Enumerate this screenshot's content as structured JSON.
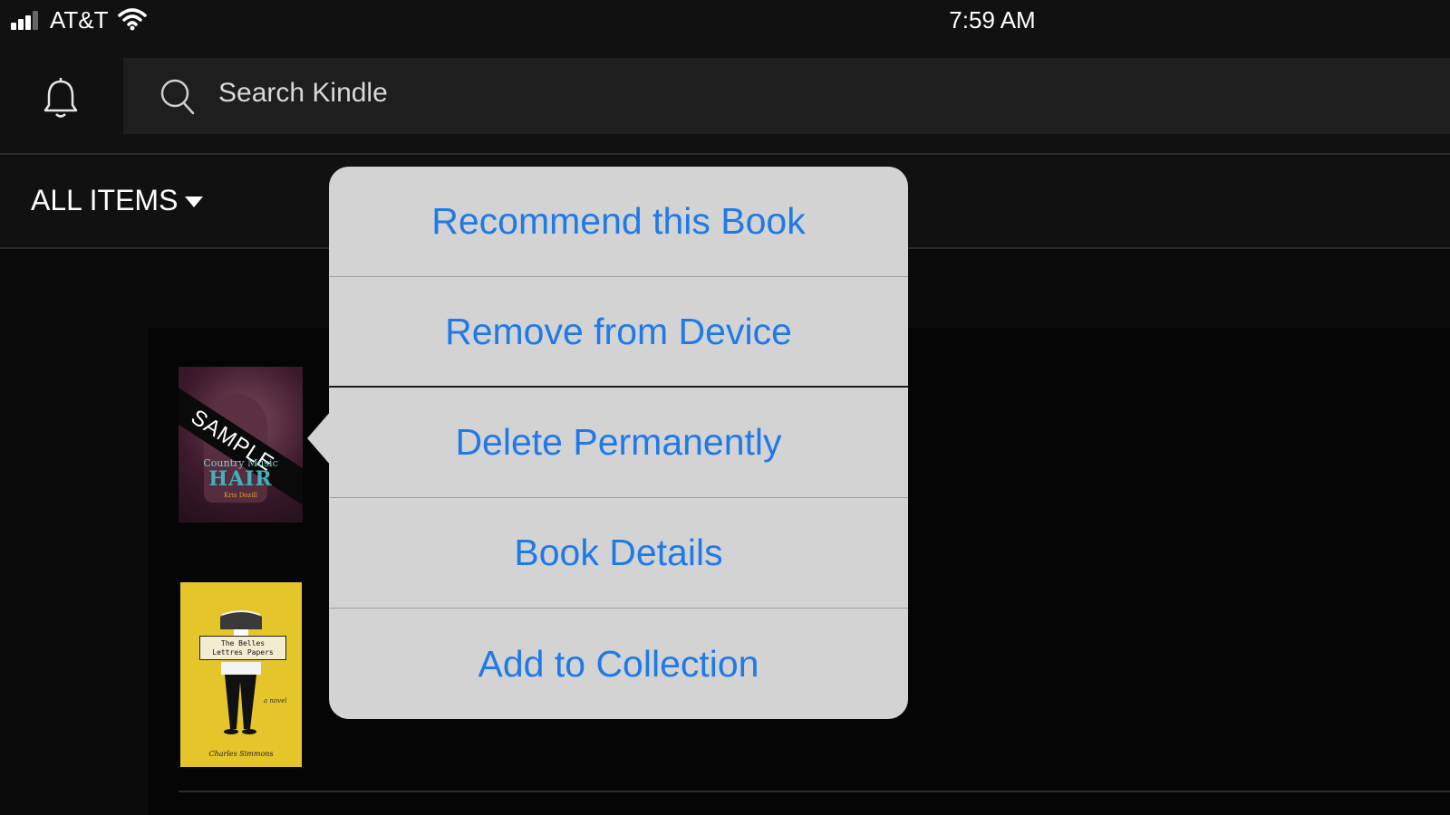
{
  "status_bar": {
    "carrier": "AT&T",
    "time": "7:59 AM",
    "signal_icon": "signal-bars-icon",
    "wifi_icon": "wifi-icon"
  },
  "header": {
    "notification_icon": "bell-icon",
    "search": {
      "icon": "search-icon",
      "placeholder": "Search Kindle"
    }
  },
  "filter": {
    "label": "ALL ITEMS",
    "icon": "caret-down-icon"
  },
  "library": {
    "books": [
      {
        "badge": "SAMPLE",
        "cover_title_line1": "Country Music",
        "cover_title_line2": "HAIR",
        "cover_author": "Kris Dozill"
      },
      {
        "cover_title_line1": "The Belles",
        "cover_title_line2": "Lettres Papers",
        "cover_subtitle": "a novel",
        "cover_author": "Charles Simmons"
      }
    ]
  },
  "context_menu": {
    "items": [
      {
        "label": "Recommend this Book"
      },
      {
        "label": "Remove from Device"
      },
      {
        "label": "Delete Permanently"
      },
      {
        "label": "Book Details"
      },
      {
        "label": "Add to Collection"
      }
    ]
  },
  "colors": {
    "accent": "#1f7ae8",
    "popover_bg": "#d3d3d3",
    "app_bg": "#0b0b0b"
  }
}
